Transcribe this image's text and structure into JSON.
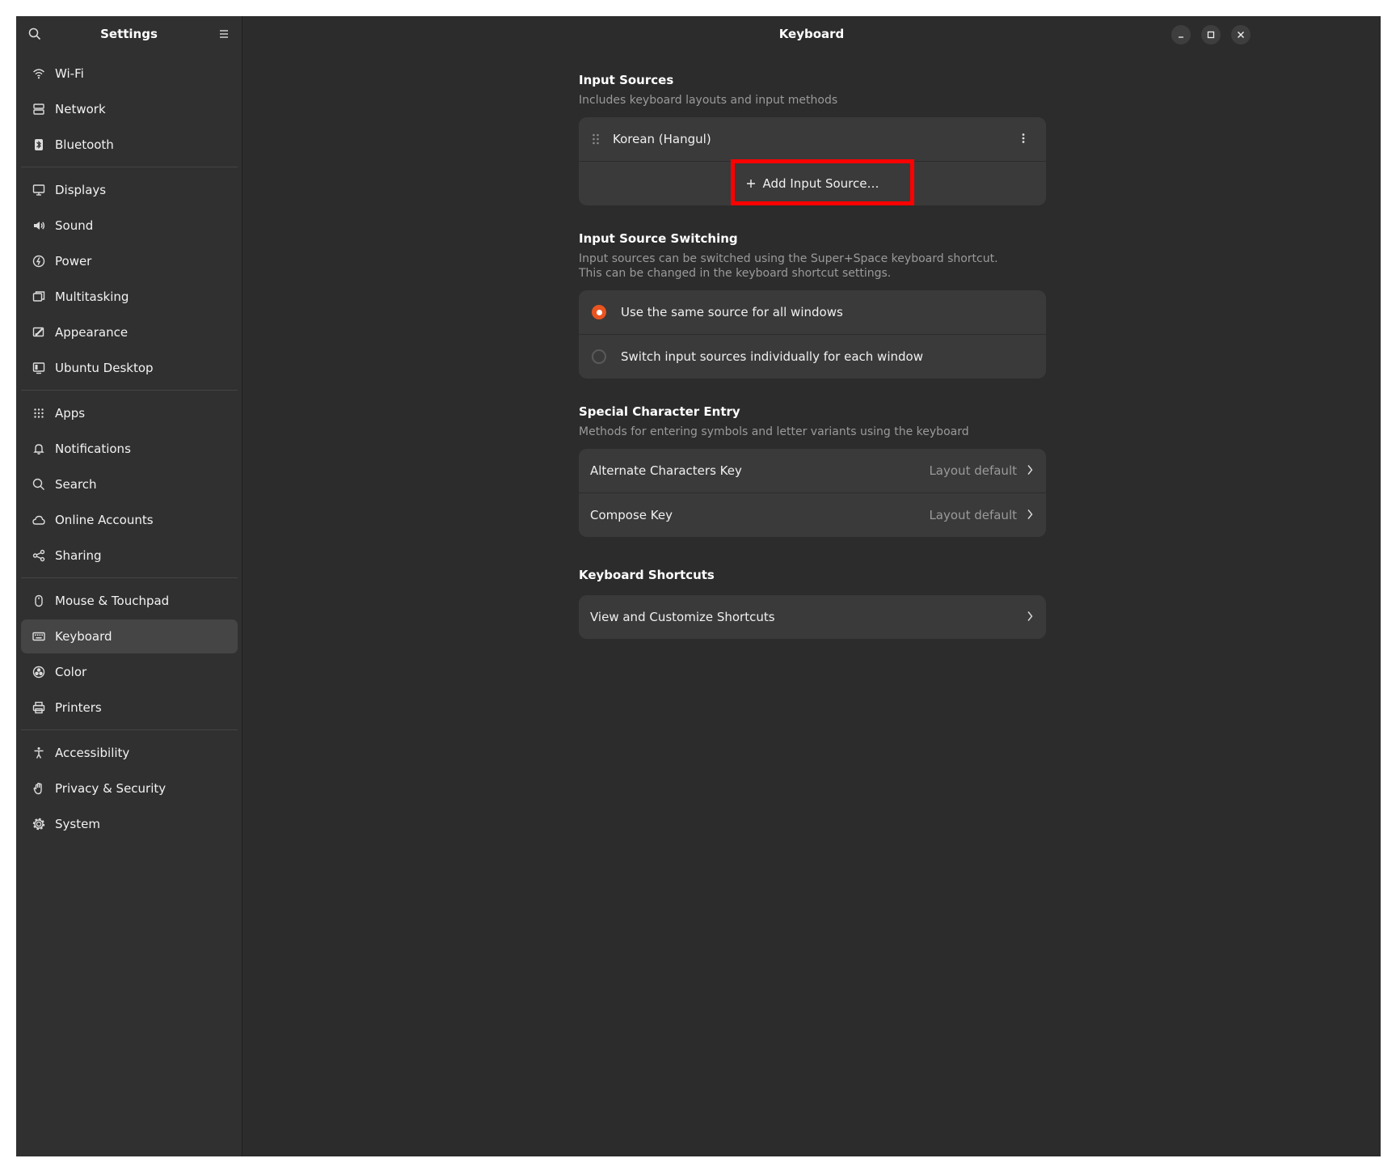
{
  "sidebar": {
    "title": "Settings",
    "groups": [
      [
        {
          "label": "Wi-Fi",
          "icon": "wifi-icon"
        },
        {
          "label": "Network",
          "icon": "network-icon"
        },
        {
          "label": "Bluetooth",
          "icon": "bluetooth-icon"
        }
      ],
      [
        {
          "label": "Displays",
          "icon": "display-icon"
        },
        {
          "label": "Sound",
          "icon": "sound-icon"
        },
        {
          "label": "Power",
          "icon": "power-icon"
        },
        {
          "label": "Multitasking",
          "icon": "multitasking-icon"
        },
        {
          "label": "Appearance",
          "icon": "appearance-icon"
        },
        {
          "label": "Ubuntu Desktop",
          "icon": "ubuntu-desktop-icon"
        }
      ],
      [
        {
          "label": "Apps",
          "icon": "apps-icon"
        },
        {
          "label": "Notifications",
          "icon": "bell-icon"
        },
        {
          "label": "Search",
          "icon": "search-icon"
        },
        {
          "label": "Online Accounts",
          "icon": "cloud-icon"
        },
        {
          "label": "Sharing",
          "icon": "share-icon"
        }
      ],
      [
        {
          "label": "Mouse & Touchpad",
          "icon": "mouse-icon"
        },
        {
          "label": "Keyboard",
          "icon": "keyboard-icon",
          "active": true
        },
        {
          "label": "Color",
          "icon": "color-icon"
        },
        {
          "label": "Printers",
          "icon": "printer-icon"
        }
      ],
      [
        {
          "label": "Accessibility",
          "icon": "accessibility-icon"
        },
        {
          "label": "Privacy & Security",
          "icon": "privacy-hand-icon"
        },
        {
          "label": "System",
          "icon": "system-gear-icon"
        }
      ]
    ]
  },
  "header": {
    "title": "Keyboard"
  },
  "input_sources": {
    "title": "Input Sources",
    "subtitle": "Includes keyboard layouts and input methods",
    "sources": [
      "Korean (Hangul)"
    ],
    "add_label": "Add Input Source…"
  },
  "switching": {
    "title": "Input Source Switching",
    "subtitle_line1": "Input sources can be switched using the Super+Space keyboard shortcut.",
    "subtitle_line2": "This can be changed in the keyboard shortcut settings.",
    "options": [
      {
        "label": "Use the same source for all windows",
        "selected": true
      },
      {
        "label": "Switch input sources individually for each window",
        "selected": false
      }
    ]
  },
  "special": {
    "title": "Special Character Entry",
    "subtitle": "Methods for entering symbols and letter variants using the keyboard",
    "rows": [
      {
        "label": "Alternate Characters Key",
        "value": "Layout default"
      },
      {
        "label": "Compose Key",
        "value": "Layout default"
      }
    ]
  },
  "shortcuts": {
    "title": "Keyboard Shortcuts",
    "row_label": "View and Customize Shortcuts"
  },
  "colors": {
    "accent": "#e95420",
    "highlight": "#ff0000"
  }
}
